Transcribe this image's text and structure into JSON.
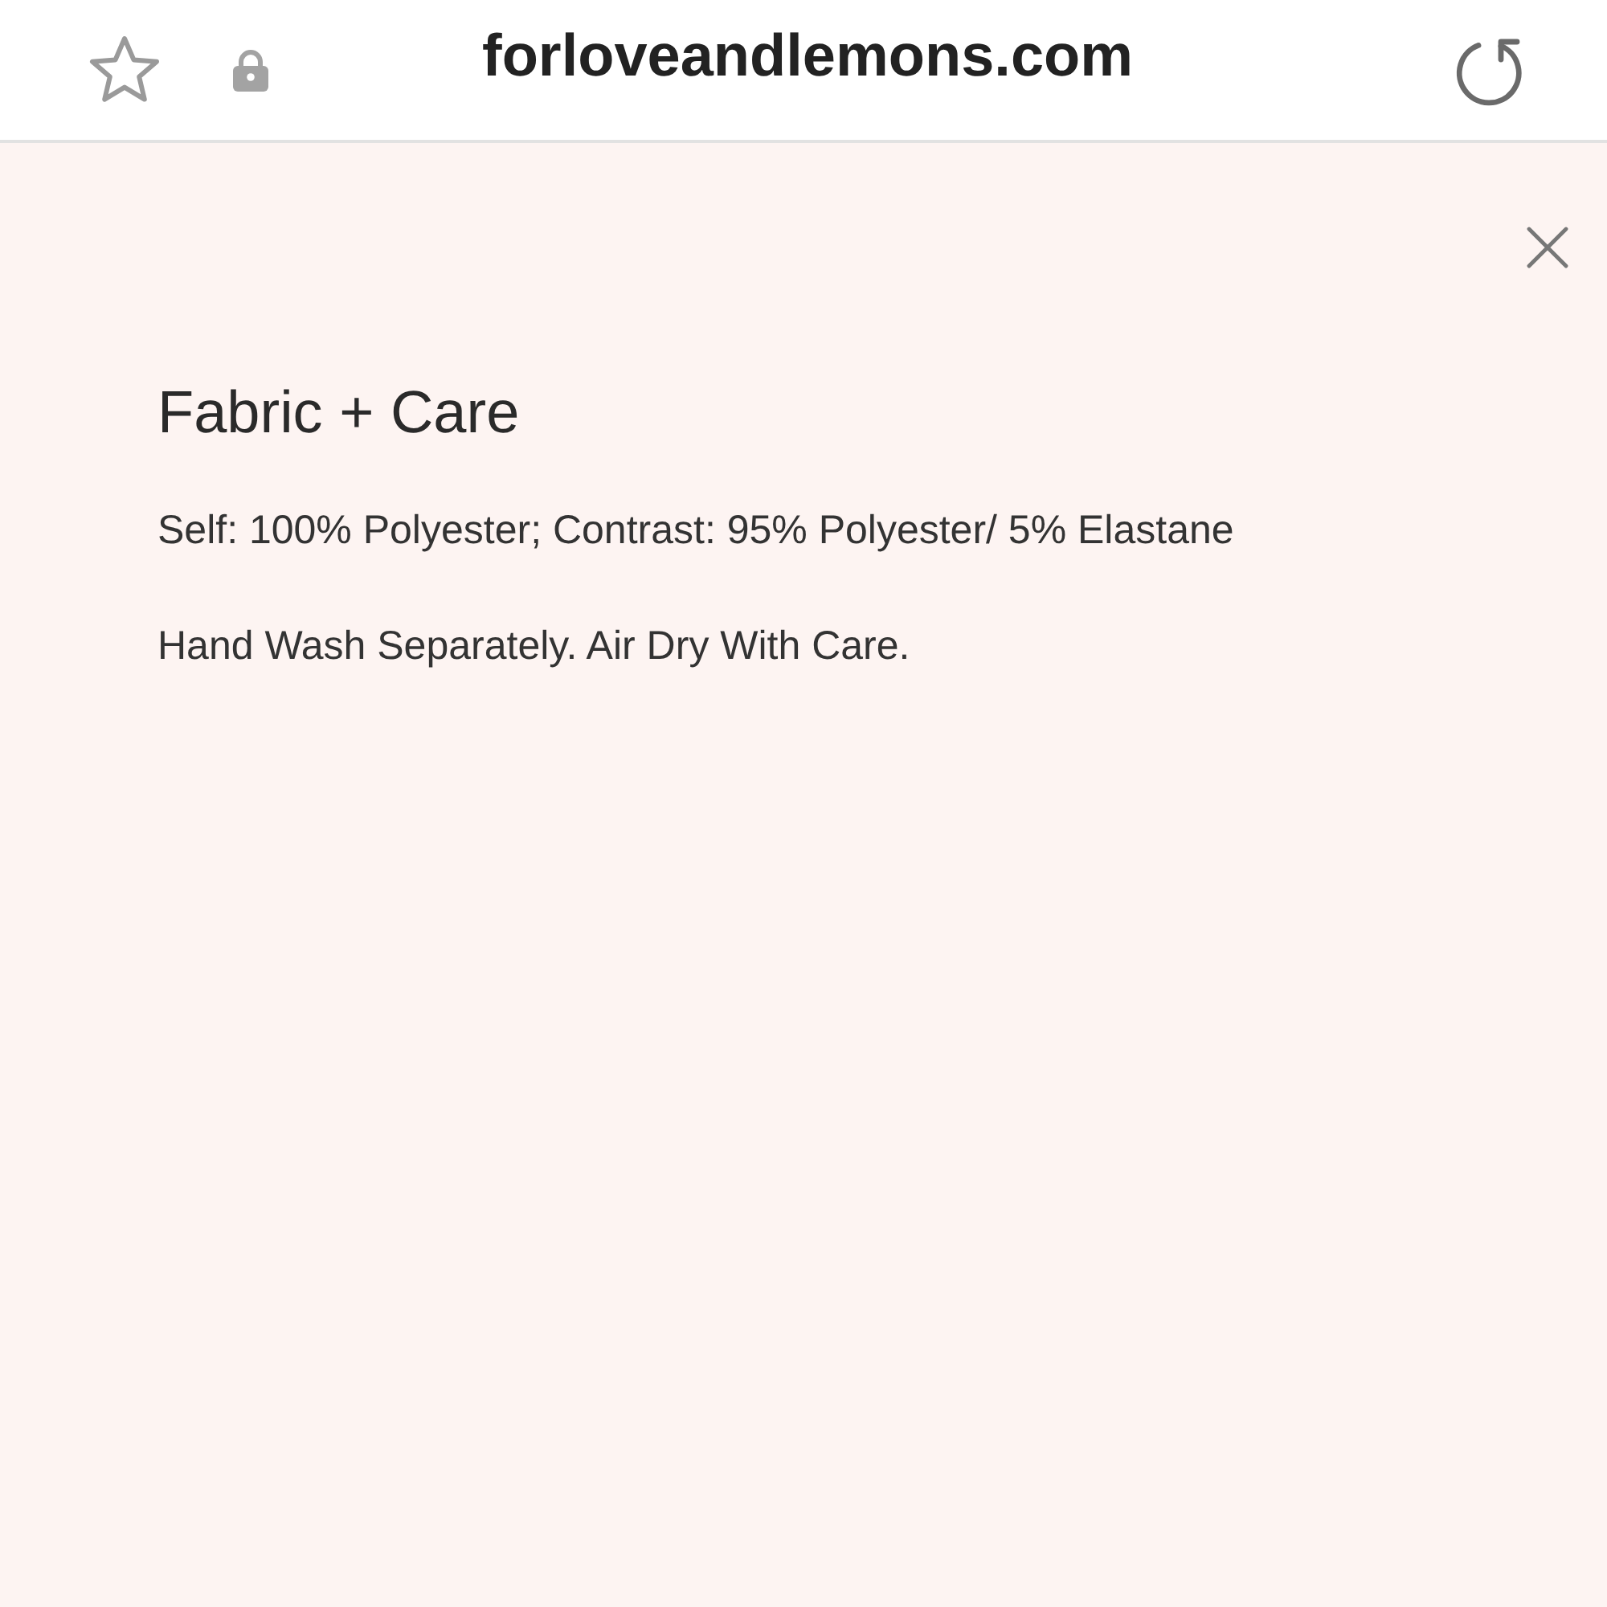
{
  "browser_bar": {
    "url": "forloveandlemons.com"
  },
  "panel": {
    "title": "Fabric + Care",
    "paragraphs": [
      "Self: 100% Polyester; Contrast: 95% Polyester/ 5% Elastane",
      "Hand Wash Separately. Air Dry With Care."
    ]
  }
}
